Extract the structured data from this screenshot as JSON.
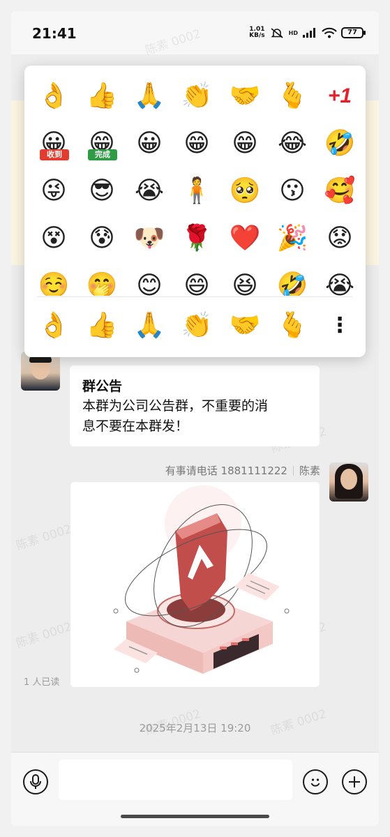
{
  "status_bar": {
    "time": "21:41",
    "net_speed_top": "1.01",
    "net_speed_unit": "KB/s",
    "network_type": "HD",
    "battery": "77"
  },
  "emoji_panel": {
    "emojis": [
      "👌",
      "👍",
      "🙏",
      "👏",
      "🤝",
      "🫰",
      "+1",
      "收到",
      "完成",
      "😀",
      "😁",
      "😁",
      "😂",
      "🤣",
      "😜",
      "😎",
      "😭",
      "🧍",
      "🥺",
      "😗",
      "🥰",
      "😵",
      "😰",
      "🐶",
      "🌹",
      "❤️",
      "🎉",
      "😟",
      "☺️",
      "🤭",
      "😊",
      "😄",
      "😆",
      "🤣",
      "😭"
    ],
    "tag_received": "收到",
    "tag_done": "完成",
    "plus_one": "+1",
    "recent": [
      "👌",
      "👍",
      "🙏",
      "👏",
      "🤝",
      "🫰"
    ],
    "more_icon": "more-vertical-icon"
  },
  "chat": {
    "announcement_title": "群公告",
    "announcement_body_line1": "本群为公司公告群，不重要的消",
    "announcement_body_line2": "息不要在本群发！",
    "sender_note": "有事请电话 1881111222",
    "sender_name": "陈素",
    "read_receipt": "1 人已读",
    "timestamp": "2025年2月13日 19:20"
  },
  "input": {
    "placeholder": "",
    "voice_icon": "microphone-icon",
    "emoji_icon": "smiley-icon",
    "plus_icon": "plus-icon"
  },
  "watermark": "陈素 0002",
  "colors": {
    "bg": "#ededed",
    "popup": "#ffffff",
    "announce_band": "#fbf4e1",
    "tag_red": "#e03c2f",
    "tag_green": "#2f9b45",
    "plus_one": "#e4212a"
  }
}
